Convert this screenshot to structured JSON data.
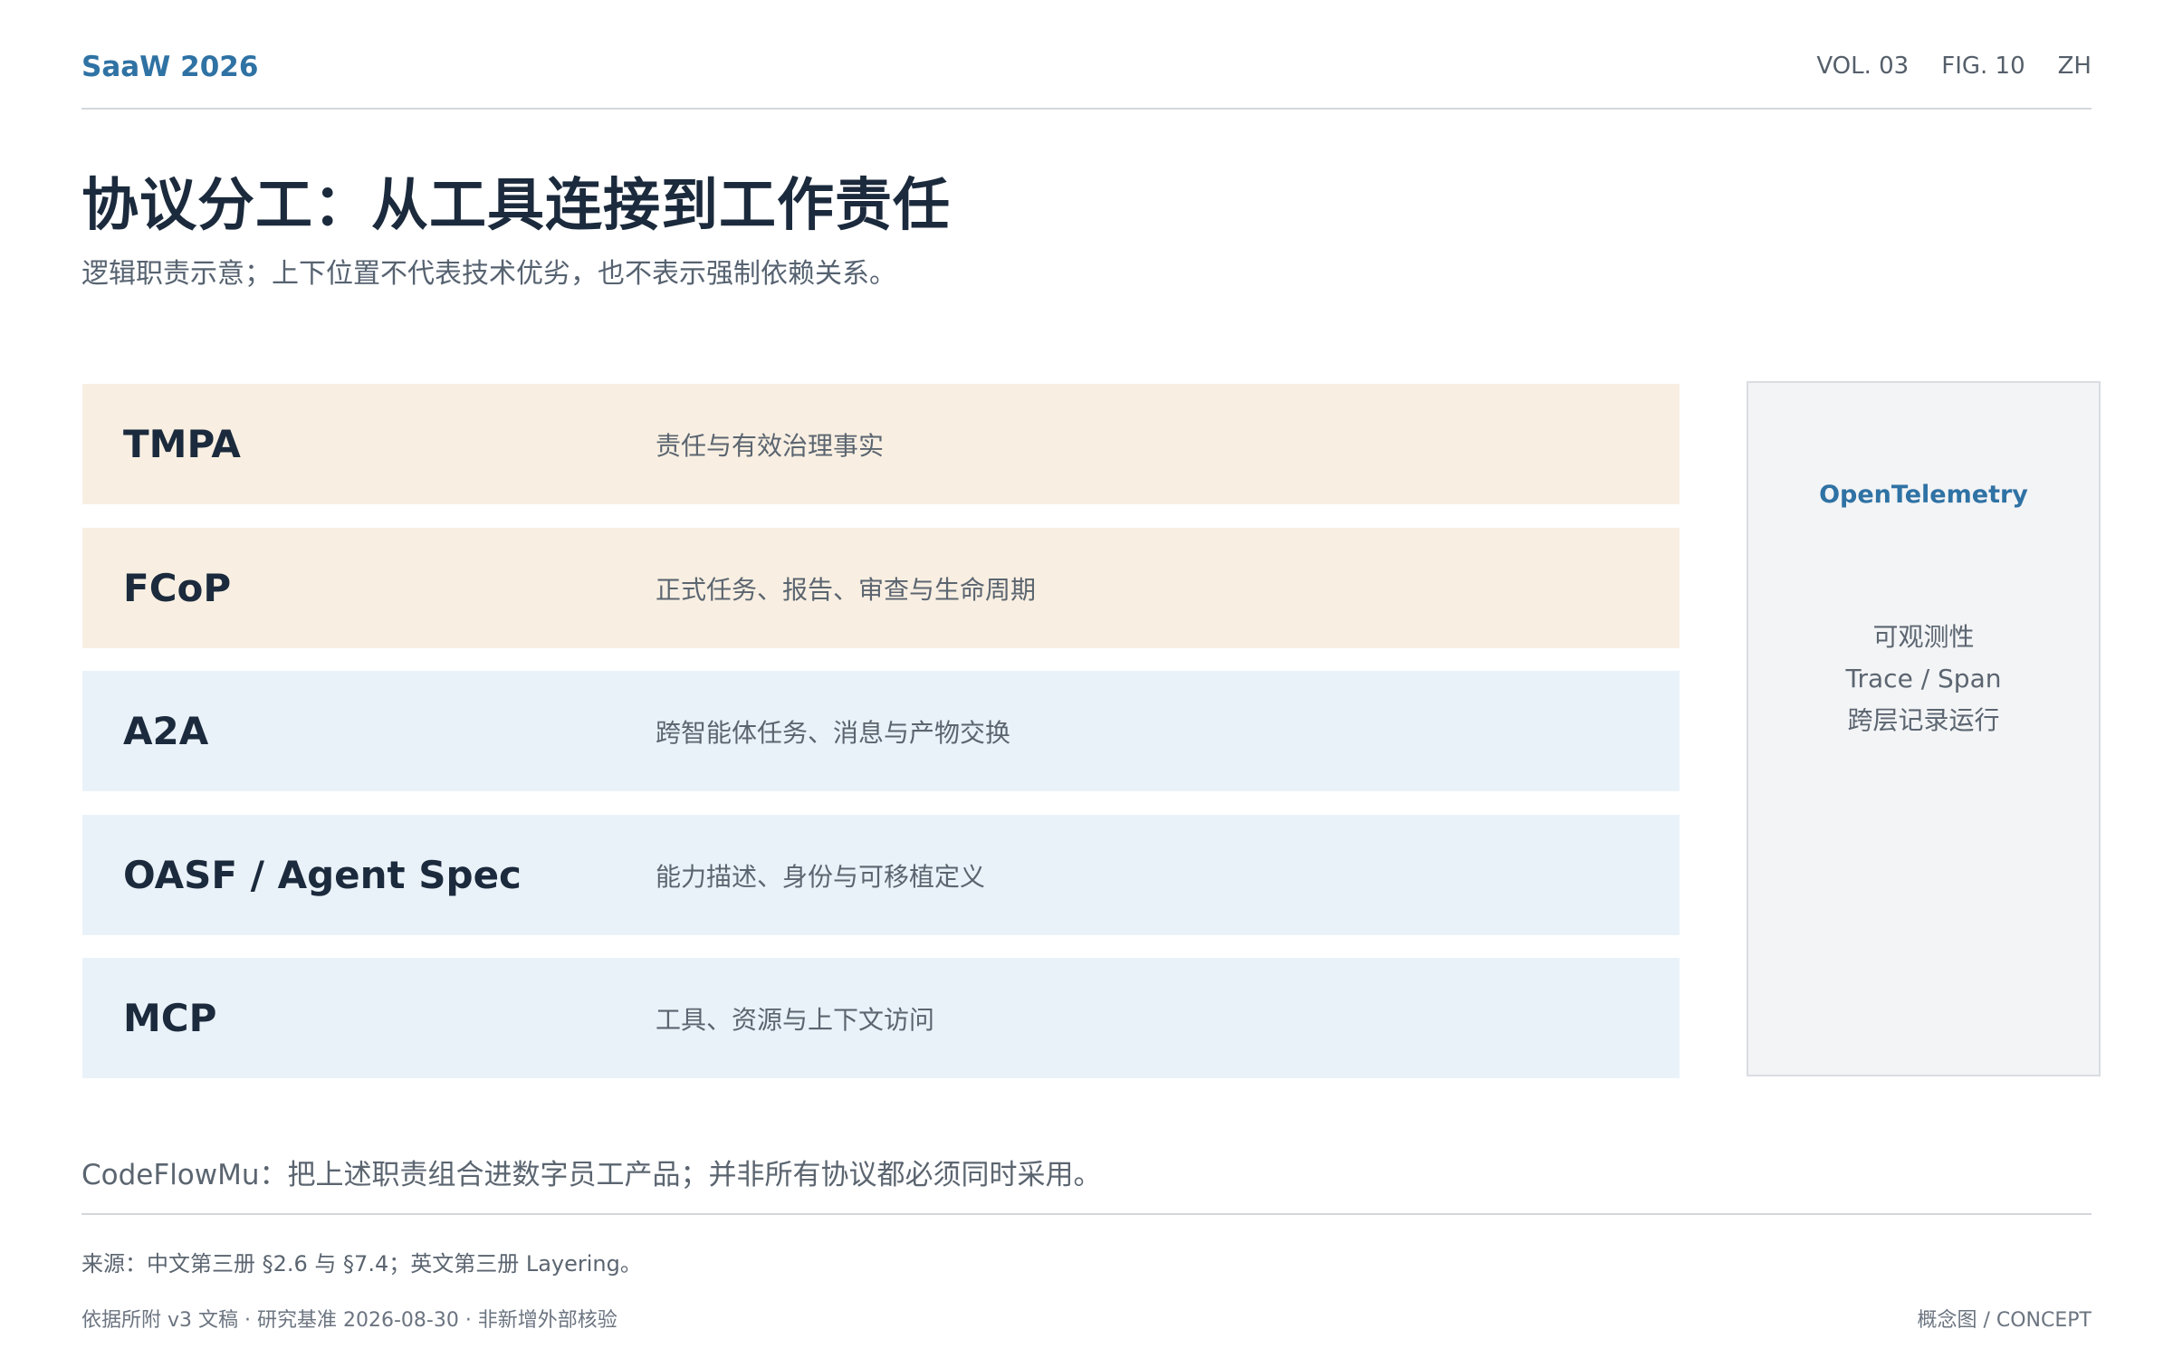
{
  "header": {
    "brand": "SaaW 2026",
    "vol": "VOL. 03",
    "fig": "FIG. 10",
    "lang": "ZH"
  },
  "title": "协议分工：从工具连接到工作责任",
  "subtitle": "逻辑职责示意；上下位置不代表技术优劣，也不表示强制依赖关系。",
  "layers": [
    {
      "name": "TMPA",
      "desc": "责任与有效治理事实",
      "tone": "warm"
    },
    {
      "name": "FCoP",
      "desc": "正式任务、报告、审查与生命周期",
      "tone": "warm"
    },
    {
      "name": "A2A",
      "desc": "跨智能体任务、消息与产物交换",
      "tone": "cool"
    },
    {
      "name": "OASF / Agent Spec",
      "desc": "能力描述、身份与可移植定义",
      "tone": "cool"
    },
    {
      "name": "MCP",
      "desc": "工具、资源与上下文访问",
      "tone": "cool"
    }
  ],
  "sidebar": {
    "title": "OpenTelemetry",
    "lines": [
      "可观测性",
      "Trace / Span",
      "跨层记录运行"
    ]
  },
  "note": "CodeFlowMu：把上述职责组合进数字员工产品；并非所有协议都必须同时采用。",
  "source": "来源：中文第三册 §2.6 与 §7.4；英文第三册 Layering。",
  "footer": {
    "left": "依据所附 v3 文稿 · 研究基准 2026-08-30 · 非新增外部核验",
    "right": "概念图 / CONCEPT"
  },
  "colors": {
    "accent": "#2f72a4",
    "warm": "#f8efe2",
    "cool": "#eaf2f9",
    "sidebar_bg": "#f3f4f6"
  }
}
